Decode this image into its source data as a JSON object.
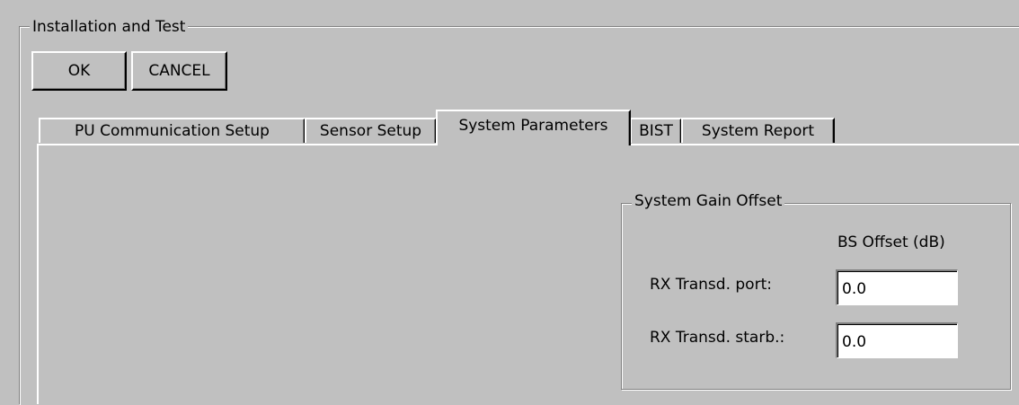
{
  "group": {
    "title": "Installation and Test"
  },
  "buttons": {
    "ok_label": "OK",
    "cancel_label": "CANCEL"
  },
  "tabs": [
    {
      "label": "PU Communication Setup",
      "active": false
    },
    {
      "label": "Sensor Setup",
      "active": false
    },
    {
      "label": "System Parameters",
      "active": true
    },
    {
      "label": "BIST",
      "active": false
    },
    {
      "label": "System Report",
      "active": false
    }
  ],
  "system_gain_offset": {
    "title": "System Gain Offset",
    "column_header": "BS Offset (dB)",
    "rows": [
      {
        "label": "RX Transd. port:",
        "value": "0.0"
      },
      {
        "label": "RX Transd. starb.:",
        "value": "0.0"
      }
    ]
  },
  "colors": {
    "background": "#c0c0c0",
    "field_background": "#ffffff",
    "shadow": "#808080",
    "highlight": "#ffffff"
  }
}
